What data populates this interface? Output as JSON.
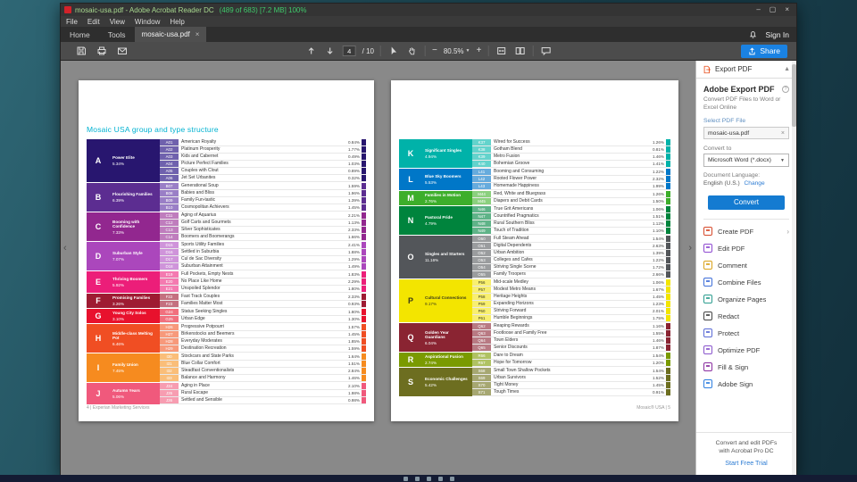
{
  "desktop": {
    "taskbar_icons": [
      "app-1",
      "app-2",
      "app-3",
      "app-4",
      "app-5"
    ]
  },
  "titlebar": {
    "title": "mosaic-usa.pdf - Adobe Acrobat Reader DC",
    "meta": "(489 of 683) [7.2 MB] 100%"
  },
  "menubar": {
    "items": [
      "File",
      "Edit",
      "View",
      "Window",
      "Help"
    ]
  },
  "tabbar": {
    "home": "Home",
    "tools": "Tools",
    "document_tab": "mosaic-usa.pdf",
    "sign_in": "Sign In"
  },
  "toolbar": {
    "page_current": "4",
    "page_of": "/ 10",
    "zoom_level": "80.5%",
    "share_label": "Share"
  },
  "doc": {
    "title": "Mosaic USA group and type structure",
    "footer_left": "4 | Experian Marketing Services",
    "footer_right": "Mosaic® USA | 5",
    "left_groups": [
      {
        "letter": "A",
        "name": "Power Elite",
        "pct": "5.34%",
        "color": "#28166f",
        "tint": "#6f61ad",
        "types": [
          {
            "code": "A01",
            "name": "American Royalty",
            "pct": "0.84%"
          },
          {
            "code": "A02",
            "name": "Platinum Prosperity",
            "pct": "1.77%"
          },
          {
            "code": "A03",
            "name": "Kids and Cabernet",
            "pct": "0.49%"
          },
          {
            "code": "A04",
            "name": "Picture Perfect Families",
            "pct": "1.03%"
          },
          {
            "code": "A05",
            "name": "Couples with Clout",
            "pct": "0.89%"
          },
          {
            "code": "A06",
            "name": "Jet Set Urbanites",
            "pct": "0.32%"
          }
        ]
      },
      {
        "letter": "B",
        "name": "Flourishing Families",
        "pct": "6.39%",
        "color": "#5c2d91",
        "tint": "#9a7fc6",
        "types": [
          {
            "code": "B07",
            "name": "Generational Soup",
            "pct": "1.59%"
          },
          {
            "code": "B08",
            "name": "Babies and Bliss",
            "pct": "1.96%"
          },
          {
            "code": "B09",
            "name": "Family Fun-tastic",
            "pct": "1.39%"
          },
          {
            "code": "B10",
            "name": "Cosmopolitan Achievers",
            "pct": "1.45%"
          }
        ]
      },
      {
        "letter": "C",
        "name": "Booming with Confidence",
        "pct": "7.33%",
        "color": "#92278f",
        "tint": "#bf7dbd",
        "types": [
          {
            "code": "C11",
            "name": "Aging of Aquarius",
            "pct": "2.21%"
          },
          {
            "code": "C12",
            "name": "Golf Carts and Gourmets",
            "pct": "1.13%"
          },
          {
            "code": "C13",
            "name": "Silver Sophisticates",
            "pct": "2.33%"
          },
          {
            "code": "C14",
            "name": "Boomers and Boomerangs",
            "pct": "1.66%"
          }
        ]
      },
      {
        "letter": "D",
        "name": "Suburban Style",
        "pct": "7.07%",
        "color": "#ab47bc",
        "tint": "#cf94da",
        "types": [
          {
            "code": "D15",
            "name": "Sports Utility Families",
            "pct": "2.41%"
          },
          {
            "code": "D16",
            "name": "Settled in Suburbia",
            "pct": "1.88%"
          },
          {
            "code": "D17",
            "name": "Cul de Sac Diversity",
            "pct": "1.29%"
          },
          {
            "code": "D18",
            "name": "Suburban Attainment",
            "pct": "1.49%"
          }
        ]
      },
      {
        "letter": "E",
        "name": "Thriving Boomers",
        "pct": "5.92%",
        "color": "#ec1e79",
        "tint": "#f47ab0",
        "types": [
          {
            "code": "E19",
            "name": "Full Pockets, Empty Nests",
            "pct": "1.83%"
          },
          {
            "code": "E20",
            "name": "No Place Like Home",
            "pct": "2.29%"
          },
          {
            "code": "E21",
            "name": "Unspoiled Splendor",
            "pct": "1.80%"
          }
        ]
      },
      {
        "letter": "F",
        "name": "Promising Families",
        "pct": "3.26%",
        "color": "#9e1b32",
        "tint": "#c4707f",
        "types": [
          {
            "code": "F22",
            "name": "Fast Track Couples",
            "pct": "2.33%"
          },
          {
            "code": "F23",
            "name": "Families Matter Most",
            "pct": "0.93%"
          }
        ]
      },
      {
        "letter": "G",
        "name": "Young City Solos",
        "pct": "3.10%",
        "color": "#e8112d",
        "tint": "#f1707e",
        "types": [
          {
            "code": "G24",
            "name": "Status Seeking Singles",
            "pct": "1.80%"
          },
          {
            "code": "G25",
            "name": "Urban Edge",
            "pct": "1.30%"
          }
        ]
      },
      {
        "letter": "H",
        "name": "Middle-class Melting Pot",
        "pct": "6.46%",
        "color": "#f04e23",
        "tint": "#f7997b",
        "types": [
          {
            "code": "H26",
            "name": "Progressive Potpourri",
            "pct": "1.57%"
          },
          {
            "code": "H27",
            "name": "Birkenstocks and Beemers",
            "pct": "1.45%"
          },
          {
            "code": "H28",
            "name": "Everyday Moderates",
            "pct": "1.85%"
          },
          {
            "code": "H29",
            "name": "Destination Recreation",
            "pct": "1.59%"
          }
        ]
      },
      {
        "letter": "I",
        "name": "Family Union",
        "pct": "7.45%",
        "color": "#f68b1f",
        "tint": "#fabe79",
        "types": [
          {
            "code": "I30",
            "name": "Stockcars and State Parks",
            "pct": "1.64%"
          },
          {
            "code": "I31",
            "name": "Blue Collar Comfort",
            "pct": "1.51%"
          },
          {
            "code": "I32",
            "name": "Steadfast Conventionalists",
            "pct": "2.84%"
          },
          {
            "code": "I33",
            "name": "Balance and Harmony",
            "pct": "1.46%"
          }
        ]
      },
      {
        "letter": "J",
        "name": "Autumn Years",
        "pct": "5.06%",
        "color": "#f0597c",
        "tint": "#f79db1",
        "types": [
          {
            "code": "J34",
            "name": "Aging in Place",
            "pct": "2.10%"
          },
          {
            "code": "J35",
            "name": "Rural Escape",
            "pct": "1.98%"
          },
          {
            "code": "J36",
            "name": "Settled and Sensible",
            "pct": "0.98%"
          }
        ]
      }
    ],
    "right_groups": [
      {
        "letter": "K",
        "name": "Significant Singles",
        "pct": "4.94%",
        "color": "#00b2a9",
        "tint": "#63d3cc",
        "types": [
          {
            "code": "K37",
            "name": "Wired for Success",
            "pct": "1.26%"
          },
          {
            "code": "K38",
            "name": "Gotham Blend",
            "pct": "0.81%"
          },
          {
            "code": "K39",
            "name": "Metro Fusion",
            "pct": "1.46%"
          },
          {
            "code": "K40",
            "name": "Bohemian Groove",
            "pct": "1.41%"
          }
        ]
      },
      {
        "letter": "L",
        "name": "Blue Sky Boomers",
        "pct": "5.53%",
        "color": "#0077c8",
        "tint": "#66abdd",
        "types": [
          {
            "code": "L41",
            "name": "Booming and Consuming",
            "pct": "1.22%"
          },
          {
            "code": "L42",
            "name": "Rooted Flower Power",
            "pct": "2.32%"
          },
          {
            "code": "L43",
            "name": "Homemade Happiness",
            "pct": "1.99%"
          }
        ]
      },
      {
        "letter": "M",
        "name": "Families in Motion",
        "pct": "2.76%",
        "color": "#3dae2b",
        "tint": "#8bd07e",
        "types": [
          {
            "code": "M44",
            "name": "Red, White and Bluegrass",
            "pct": "1.26%"
          },
          {
            "code": "M45",
            "name": "Diapers and Debit Cards",
            "pct": "1.50%"
          }
        ]
      },
      {
        "letter": "N",
        "name": "Pastoral Pride",
        "pct": "4.79%",
        "color": "#00843d",
        "tint": "#5fb388",
        "types": [
          {
            "code": "N46",
            "name": "True Grit Americans",
            "pct": "1.06%"
          },
          {
            "code": "N47",
            "name": "Countrified Pragmatics",
            "pct": "1.51%"
          },
          {
            "code": "N48",
            "name": "Rural Southern Bliss",
            "pct": "1.12%"
          },
          {
            "code": "N49",
            "name": "Touch of Tradition",
            "pct": "1.10%"
          }
        ]
      },
      {
        "letter": "O",
        "name": "Singles and Starters",
        "pct": "11.16%",
        "color": "#53565a",
        "tint": "#9a9c9e",
        "types": [
          {
            "code": "O50",
            "name": "Full Steam Ahead",
            "pct": "1.54%"
          },
          {
            "code": "O51",
            "name": "Digital Dependents",
            "pct": "2.63%"
          },
          {
            "code": "O52",
            "name": "Urban Ambition",
            "pct": "1.39%"
          },
          {
            "code": "O53",
            "name": "Colleges and Cafes",
            "pct": "1.22%"
          },
          {
            "code": "O54",
            "name": "Striving Single Scene",
            "pct": "1.72%"
          },
          {
            "code": "O55",
            "name": "Family Troopers",
            "pct": "2.66%"
          }
        ]
      },
      {
        "letter": "P",
        "name": "Cultural Connections",
        "pct": "9.17%",
        "color": "#f3e500",
        "tint": "#f8ef70",
        "text": "#3a3a1a",
        "types": [
          {
            "code": "P56",
            "name": "Mid-scale Medley",
            "pct": "1.06%"
          },
          {
            "code": "P57",
            "name": "Modest Metro Means",
            "pct": "1.67%"
          },
          {
            "code": "P58",
            "name": "Heritage Heights",
            "pct": "1.45%"
          },
          {
            "code": "P59",
            "name": "Expanding Horizons",
            "pct": "1.23%"
          },
          {
            "code": "P60",
            "name": "Striving Forward",
            "pct": "2.01%"
          },
          {
            "code": "P61",
            "name": "Humble Beginnings",
            "pct": "1.75%"
          }
        ]
      },
      {
        "letter": "Q",
        "name": "Golden Year Guardians",
        "pct": "6.04%",
        "color": "#8a2432",
        "tint": "#b87a83",
        "types": [
          {
            "code": "Q62",
            "name": "Reaping Rewards",
            "pct": "1.16%"
          },
          {
            "code": "Q63",
            "name": "Footloose and Family Free",
            "pct": "1.55%"
          },
          {
            "code": "Q64",
            "name": "Town Elders",
            "pct": "1.46%"
          },
          {
            "code": "Q65",
            "name": "Senior Discounts",
            "pct": "1.87%"
          }
        ]
      },
      {
        "letter": "R",
        "name": "Aspirational Fusion",
        "pct": "2.74%",
        "color": "#7a9a01",
        "tint": "#afc262",
        "types": [
          {
            "code": "R66",
            "name": "Dare to Dream",
            "pct": "1.54%"
          },
          {
            "code": "R67",
            "name": "Hope for Tomorrow",
            "pct": "1.20%"
          }
        ]
      },
      {
        "letter": "S",
        "name": "Economic Challenges",
        "pct": "5.42%",
        "color": "#6d6e20",
        "tint": "#a6a772",
        "types": [
          {
            "code": "S68",
            "name": "Small Town Shallow Pockets",
            "pct": "1.54%"
          },
          {
            "code": "S69",
            "name": "Urban Survivors",
            "pct": "1.52%"
          },
          {
            "code": "S70",
            "name": "Tight Money",
            "pct": "1.45%"
          },
          {
            "code": "S71",
            "name": "Tough Times",
            "pct": "0.91%"
          }
        ]
      }
    ]
  },
  "sidebar": {
    "panel_title": "Export PDF",
    "heading": "Adobe Export PDF",
    "description": "Convert PDF Files to Word or Excel Online",
    "select_label": "Select PDF File",
    "file_name": "mosaic-usa.pdf",
    "convert_to_label": "Convert to",
    "format_value": "Microsoft Word (*.docx)",
    "language_label": "Document Language:",
    "language_value": "English (U.S.)",
    "language_change": "Change",
    "convert_button": "Convert",
    "tools": [
      {
        "label": "Create PDF",
        "icon": "create-pdf-icon",
        "color": "#d6492a",
        "chevron": true
      },
      {
        "label": "Edit PDF",
        "icon": "edit-pdf-icon",
        "color": "#8f4bd1"
      },
      {
        "label": "Comment",
        "icon": "comment-icon",
        "color": "#d9a21b"
      },
      {
        "label": "Combine Files",
        "icon": "combine-files-icon",
        "color": "#3f6fd8"
      },
      {
        "label": "Organize Pages",
        "icon": "organize-pages-icon",
        "color": "#2d9d8f"
      },
      {
        "label": "Redact",
        "icon": "redact-icon",
        "color": "#444444"
      },
      {
        "label": "Protect",
        "icon": "protect-icon",
        "color": "#5b6bd6"
      },
      {
        "label": "Optimize PDF",
        "icon": "optimize-pdf-icon",
        "color": "#8a56cc"
      },
      {
        "label": "Fill & Sign",
        "icon": "fill-sign-icon",
        "color": "#8a2ea0"
      },
      {
        "label": "Adobe Sign",
        "icon": "adobe-sign-icon",
        "color": "#2f7fe0"
      }
    ],
    "promo_line1": "Convert and edit PDFs",
    "promo_line2": "with Acrobat Pro DC",
    "promo_link": "Start Free Trial"
  }
}
